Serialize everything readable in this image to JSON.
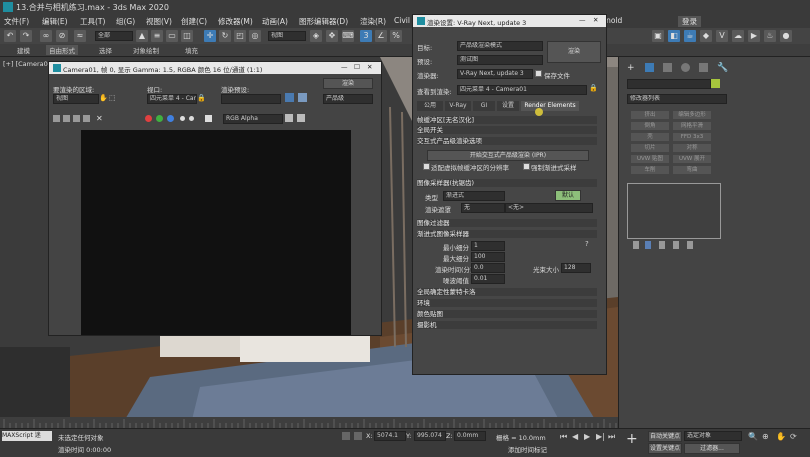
{
  "window": {
    "title": "13.合并与相机练习.max - 3ds Max 2020"
  },
  "menu": [
    "文件(F)",
    "编辑(E)",
    "工具(T)",
    "组(G)",
    "视图(V)",
    "创建(C)",
    "修改器(M)",
    "动画(A)",
    "图形编辑器(D)",
    "渲染(R)",
    "Civil",
    "Arnold"
  ],
  "user_badge": "登录",
  "toolbar": {
    "filter": "全部",
    "view": "视图"
  },
  "ribbon": [
    "建模",
    "自由形式",
    "选择",
    "对象绘制",
    "填充"
  ],
  "viewport": {
    "label": "[+] [Camera01]"
  },
  "frame_buffer": {
    "title": "Camera01, 帧 0, 显示 Gamma: 1.5, RGBA 颜色 16 位/通道 (1:1)",
    "area_label": "要渲染的区域:",
    "area_value": "视图",
    "viewport_label": "视口:",
    "viewport_value": "四元菜单 4 - Camera01",
    "preset_label": "渲染预设:",
    "render_button": "渲染",
    "product_value": "产品级",
    "channel_value": "RGB Alpha"
  },
  "render_setup": {
    "title": "渲染设置: V-Ray Next, update 3",
    "target_label": "目标:",
    "target_value": "产品级渲染模式",
    "preset_label": "预设:",
    "preset_value": "测试图",
    "renderer_label": "渲染器:",
    "renderer_value": "V-Ray Next, update 3",
    "save_file_label": "保存文件",
    "view_label": "查看到渲染:",
    "view_value": "四元菜单 4 - Camera01",
    "render_button": "渲染",
    "tabs": [
      "公用",
      "V-Ray",
      "GI",
      "设置",
      "Render Elements"
    ],
    "sections": {
      "frame_buffer": "帧缓冲区[无名汉化]",
      "global": "全局开关",
      "ipr": "交互式产品级渲染选项",
      "ipr_button": "开始交互式产品级渲染 (IPR)",
      "fit_vfb": "适配虚拟帧缓冲区的分辨率",
      "force_progressive": "强制渐进式采样",
      "image_sampler": "图像采样器(抗锯齿)",
      "type_label": "类型",
      "type_value": "渐进式",
      "default_button": "默认",
      "render_mask_label": "渲染遮罩",
      "render_mask_value": "无",
      "render_mask_value2": "<无>",
      "image_filter": "图像过滤器",
      "progressive_sampler": "渐进式图像采样器",
      "min_sub_label": "最小细分",
      "min_sub_value": "1",
      "max_sub_label": "最大细分",
      "max_sub_value": "100",
      "time_label": "渲染时间(分)",
      "time_value": "0.0",
      "bundle_label": "光束大小",
      "bundle_value": "128",
      "noise_label": "噪波阈值",
      "noise_value": "0.01",
      "global_dmc": "全局确定性蒙特卡洛",
      "environment": "环境",
      "color_mapping": "颜色贴图",
      "camera": "摄影机"
    }
  },
  "command_panel": {
    "modifier_list": "修改器列表",
    "buttons": [
      "挤出",
      "编辑多边形",
      "倒角",
      "网格平滑",
      "壳",
      "FFD 3x3",
      "切片",
      "对称",
      "UVW 贴图",
      "UVW 展开",
      "车削",
      "弯曲"
    ]
  },
  "status": {
    "script_label": "MAXScript 迷",
    "msg1": "未选定任何对象",
    "msg2": "渲染时间 0:00:00",
    "x_label": "X:",
    "x_value": "5074.1",
    "y_label": "Y:",
    "y_value": "995.074",
    "z_label": "Z:",
    "z_value": "0.0mm",
    "grid": "栅格 = 10.0mm",
    "add_time": "添加时间标记",
    "auto_key": "自动关键点",
    "set_key": "设置关键点",
    "selected": "选定对象",
    "filter": "过滤器..."
  },
  "colors": {
    "accent": "#3d7bb5",
    "default_button": "#8dbf7a"
  }
}
